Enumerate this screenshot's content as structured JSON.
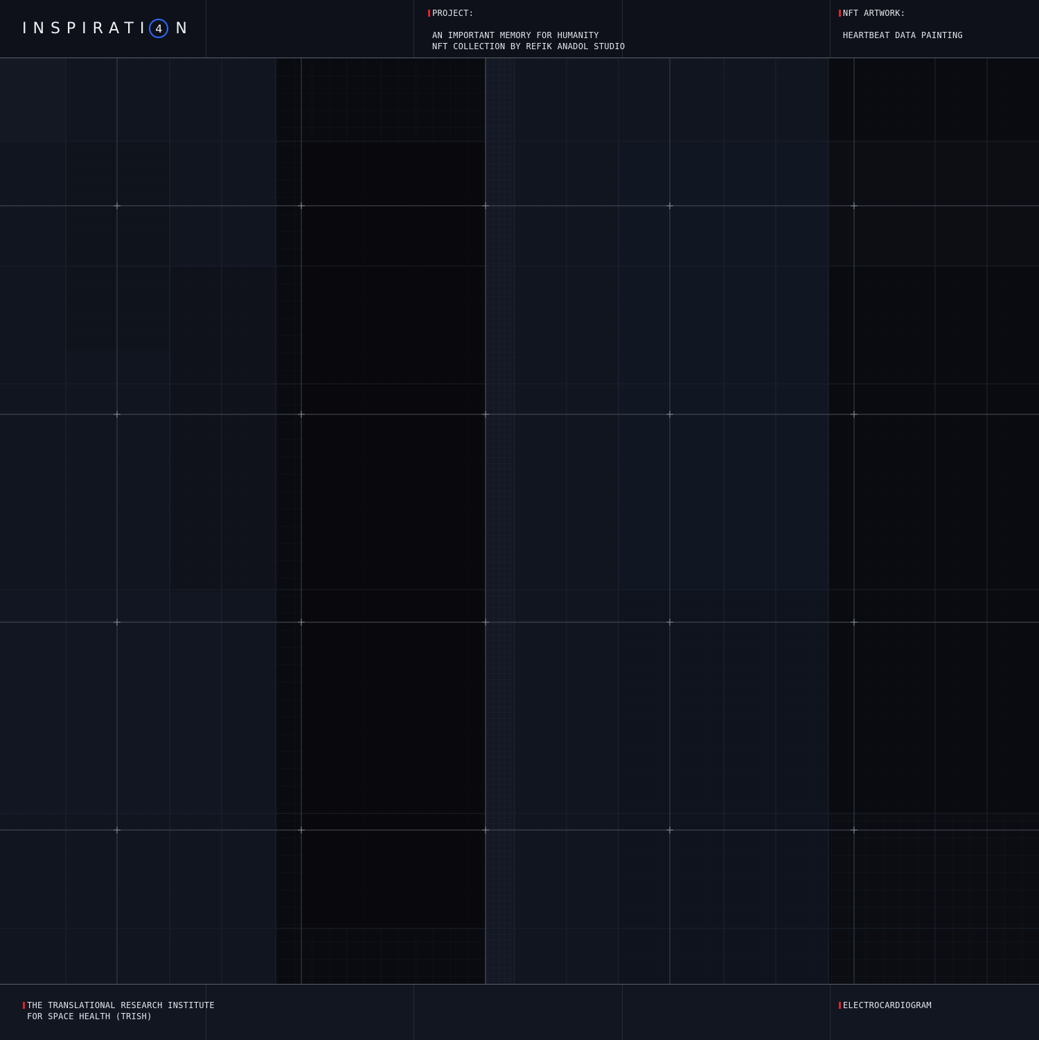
{
  "header": {
    "logo_text_left": "INSPIRATI",
    "logo_digit": "4",
    "logo_text_right": "N",
    "project_heading": "PROJECT:",
    "project_line1": "AN IMPORTANT MEMORY FOR HUMANITY",
    "project_line2": "NFT COLLECTION BY REFIK ANADOL STUDIO",
    "artwork_heading": "NFT ARTWORK:",
    "artwork_title": "HEARTBEAT DATA PAINTING"
  },
  "footer": {
    "institute_line1": "THE TRANSLATIONAL RESEARCH INSTITUTE",
    "institute_line2": "FOR SPACE HEALTH (TRISH)",
    "data_type": "ELECTROCARDIOGRAM"
  },
  "colors": {
    "accent_red": "#e0242c",
    "logo_blue": "#2f6bff",
    "background": "#0d1017"
  }
}
